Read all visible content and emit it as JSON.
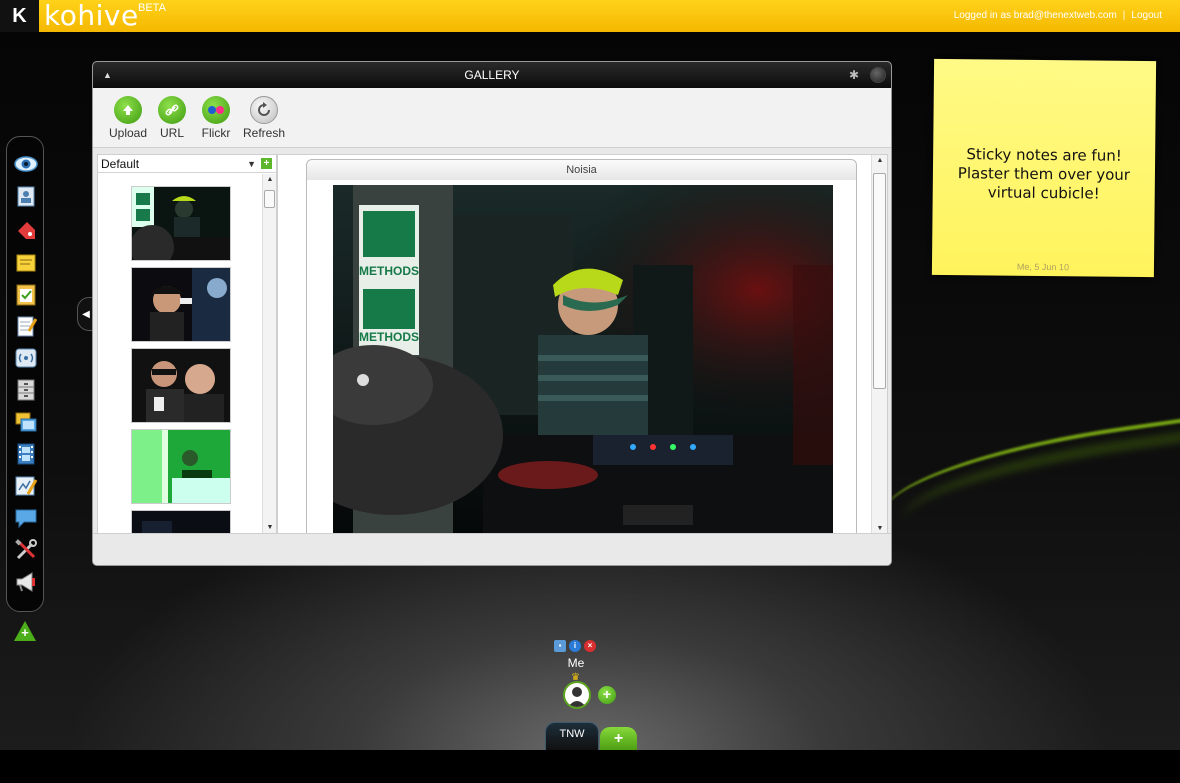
{
  "app": {
    "logo_mark": "K",
    "logo_name": "kohive",
    "beta_label": "BETA",
    "logged_in_text": "Logged in as brad@thenextweb.com",
    "separator": "|",
    "logout_label": "Logout"
  },
  "dock": {
    "icons": [
      "eye-icon",
      "contacts-icon",
      "tag-icon",
      "sticky-note-icon",
      "checklist-icon",
      "notepad-icon",
      "broadcast-icon",
      "cabinet-icon",
      "gallery-icon",
      "film-icon",
      "whiteboard-icon",
      "chat-icon",
      "tools-icon",
      "megaphone-icon"
    ],
    "toggle_glyph": "◀",
    "add_glyph": "+"
  },
  "gallery": {
    "title": "GALLERY",
    "collapse_glyph": "▲",
    "bug_glyph": "✱",
    "toolbar": {
      "upload_label": "Upload",
      "url_label": "URL",
      "flickr_label": "Flickr",
      "refresh_label": "Refresh"
    },
    "album": {
      "selected": "Default",
      "dropdown_glyph": "▼",
      "add_glyph": "+"
    },
    "photo_title": "Noisia"
  },
  "sticky": {
    "text": "Sticky notes are fun! Plaster them over your virtual cubicle!",
    "date": "Me, 5 Jun 10"
  },
  "hive": {
    "user_name": "Me",
    "tab_label": "TNW",
    "add_glyph": "+",
    "user_add_glyph": "+"
  },
  "colors": {
    "topbar": "#f5b800",
    "accent_green": "#5cb82a",
    "sticky": "#fff35c"
  }
}
